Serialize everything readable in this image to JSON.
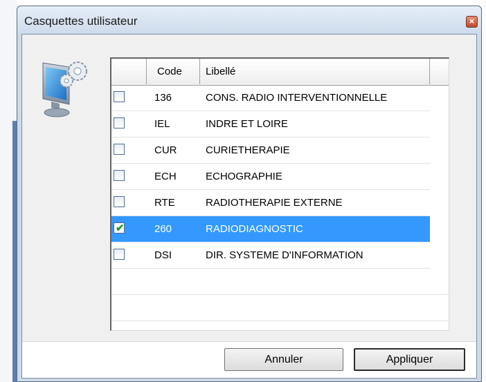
{
  "window": {
    "title": "Casquettes utilisateur"
  },
  "table": {
    "columns": [
      "Code",
      "Libellé"
    ],
    "rows": [
      {
        "code": "136",
        "label": "CONS. RADIO INTERVENTIONNELLE",
        "checked": false
      },
      {
        "code": "IEL",
        "label": "INDRE ET LOIRE",
        "checked": false
      },
      {
        "code": "CUR",
        "label": "CURIETHERAPIE",
        "checked": false
      },
      {
        "code": "ECH",
        "label": "ECHOGRAPHIE",
        "checked": false
      },
      {
        "code": "RTE",
        "label": "RADIOTHERAPIE EXTERNE",
        "checked": false
      },
      {
        "code": "260",
        "label": "RADIODIAGNOSTIC",
        "checked": true,
        "selected": true
      },
      {
        "code": "DSI",
        "label": "DIR. SYSTEME D'INFORMATION",
        "checked": false
      }
    ]
  },
  "buttons": {
    "cancel": "Annuler",
    "apply": "Appliquer"
  },
  "icons": {
    "close": "close-icon",
    "app": "computer-settings-icon",
    "check": "checkmark-icon"
  },
  "colors": {
    "selection": "#3399ff",
    "close_button": "#c4482c",
    "check": "#1e9a1e"
  }
}
